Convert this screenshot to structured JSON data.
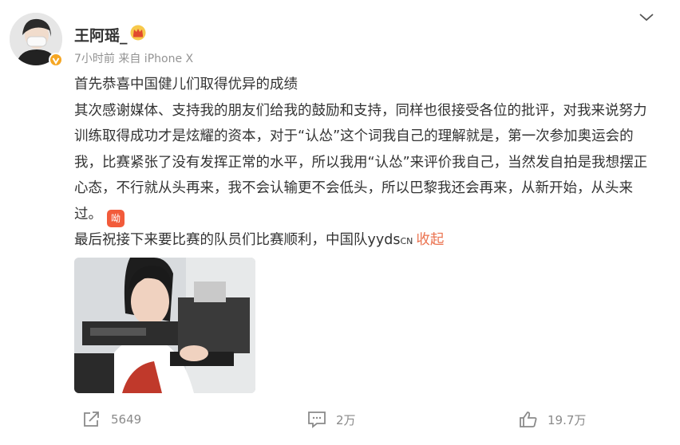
{
  "user": {
    "name": "王阿瑶_",
    "meta": "7小时前  来自 iPhone X"
  },
  "post": {
    "line1": "首先恭喜中国健儿们取得优异的成绩",
    "para2": "其次感谢媒体、支持我的朋友们给我的鼓励和支持，同样也很接受各位的批评，对我来说努力训练取得成功才是炫耀的资本，对于“认怂”这个词我自己的理解就是，第一次参加奥运会的我，比赛紧张了没有发挥正常的水平，所以我用“认怂”来评价我自己，当然发自拍是我想摆正心态，不行就从头再来，我不会认输更不会低头，所以巴黎我还会再来，从新开始，从头来过。",
    "badge": "呦",
    "line3": "最后祝接下来要比赛的队员们比赛顺利，中国队yyds",
    "line3_tag": "CN",
    "collapse": "收起"
  },
  "actions": {
    "repost": "5649",
    "comment": "2万",
    "like": "19.7万"
  },
  "colors": {
    "accent": "#eb7350",
    "muted": "#939393",
    "badge": "#f25b3b"
  },
  "icons": [
    "chevron-down-icon",
    "crown-icon",
    "verified-icon",
    "repost-icon",
    "comment-icon",
    "like-icon"
  ]
}
